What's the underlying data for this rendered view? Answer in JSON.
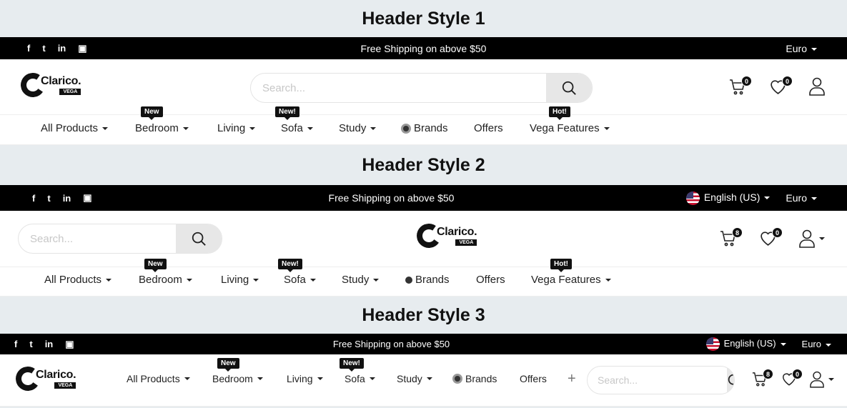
{
  "sections": [
    {
      "title": "Header Style 1"
    },
    {
      "title": "Header Style 2"
    },
    {
      "title": "Header Style 3"
    }
  ],
  "social_icons": [
    "facebook-icon",
    "twitter-icon",
    "linkedin-icon",
    "youtube-icon"
  ],
  "social_glyphs": {
    "facebook": "f",
    "twitter": "t",
    "linkedin": "in",
    "youtube": "▣"
  },
  "promo": "Free Shipping on above $50",
  "currency": "Euro",
  "language": "English (US)",
  "search_placeholder": "Search...",
  "logo": {
    "brand": "Clarico.",
    "tm": "™",
    "sub": "VEGA"
  },
  "badges": {
    "cart_h1": "0",
    "wish_h1": "0",
    "cart_h2": "8",
    "wish_h2": "0",
    "cart_h3": "8",
    "wish_h3": "0"
  },
  "nav": {
    "all_products": "All Products",
    "bedroom": "Bedroom",
    "living": "Living",
    "sofa": "Sofa",
    "study": "Study",
    "brands": "Brands",
    "offers": "Offers",
    "vega_features": "Vega Features",
    "plus": "+"
  },
  "tags": {
    "new": "New",
    "new_bang": "New!",
    "hot": "Hot!"
  },
  "colors": {
    "topbar": "#000000",
    "section_bg": "#e7ecef",
    "badge": "#111111"
  }
}
